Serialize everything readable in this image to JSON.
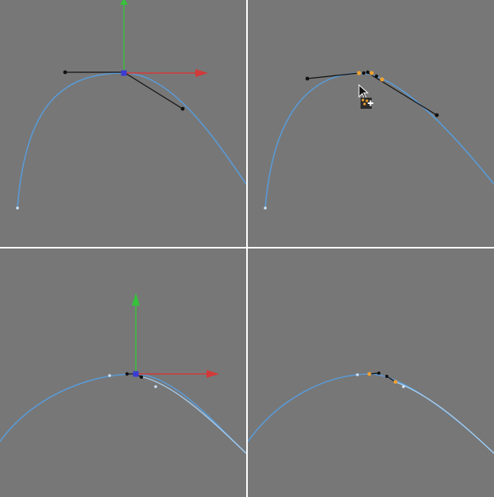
{
  "viewports": [
    {
      "id": "top-left",
      "state": "bezier handle selected, move gizmo visible"
    },
    {
      "id": "top-right",
      "state": "subdivide point cursor over handle"
    },
    {
      "id": "bottom-left",
      "state": "short handles after subdivide, move gizmo visible"
    },
    {
      "id": "bottom-right",
      "state": "subdivided points selected"
    }
  ],
  "colors": {
    "background": "#777777",
    "divider": "#ffffff",
    "curve": "#5a9ad6",
    "curve_light": "#a8ccec",
    "axis_x": "#d23a3a",
    "axis_y": "#36c23a",
    "pivot": "#3b3bd6",
    "selected_point": "#f0a030",
    "handle": "#111111"
  },
  "icons": [
    "move-gizmo-icon",
    "mouse-cursor-icon",
    "add-point-cursor-icon"
  ]
}
